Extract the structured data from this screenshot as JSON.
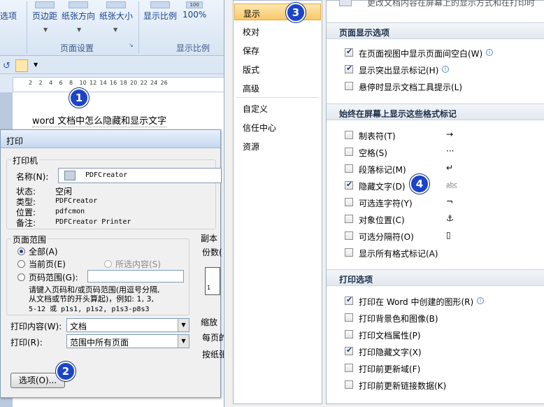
{
  "ribbon": {
    "btn_xuan": "选项",
    "btn_margins": "页边距",
    "btn_orientation": "纸张方向",
    "btn_size": "纸张大小",
    "btn_display_ratio": "显示比例",
    "btn_100": "100%",
    "group_page_setup": "页面设置",
    "group_zoom": "显示比例",
    "icon_100": "100"
  },
  "document": {
    "text": "word 文档中怎么隐藏和显示文字",
    "ruler_numbers": [
      "2",
      "2",
      "4",
      "6",
      "8",
      "10",
      "12",
      "14",
      "16",
      "18",
      "20",
      "22",
      "24",
      "26"
    ]
  },
  "badges": [
    "1",
    "2",
    "3",
    "4"
  ],
  "print_dialog": {
    "title": "打印",
    "printer_legend": "打印机",
    "name_label": "名称(N):",
    "name_value": "PDFCreator",
    "status_label": "状态:",
    "status_value": "空闲",
    "type_label": "类型:",
    "type_value": "PDFCreator",
    "location_label": "位置:",
    "location_value": "pdfcmon",
    "comment_label": "备注:",
    "comment_value": "PDFCreator Printer",
    "range_legend": "页面范围",
    "range_all": "全部(A)",
    "range_current": "当前页(E)",
    "range_selection": "所选内容(S)",
    "range_pages": "页码范围(G):",
    "range_hint_1": "请键入页码和/或页码范围(用逗号分隔,",
    "range_hint_2": "从文档或节的开头算起)，例如: 1, 3,",
    "range_hint_3": "5-12 或 p1s1, p1s2, p1s3-p8s3",
    "copies_legend": "副本",
    "copies_label": "份数(",
    "zoom_legend": "缩放",
    "per_page_label": "每页的",
    "scale_label": "按纸张",
    "print_what_label": "打印内容(W):",
    "print_what_value": "文档",
    "print_label": "打印(R):",
    "print_value": "范围中所有页面",
    "options_button": "选项(O)..."
  },
  "options_dialog": {
    "header_text": "更改文档内容在屏幕上的显示方式和在打印时",
    "nav": [
      "显示",
      "校对",
      "保存",
      "版式",
      "高级",
      "自定义",
      "信任中心",
      "资源"
    ],
    "nav_selected": "显示",
    "sections": {
      "page_display": "页面显示选项",
      "format_marks": "始终在屏幕上显示这些格式标记",
      "print_options": "打印选项"
    },
    "page_display_items": [
      {
        "label": "在页面视图中显示页面间空白(W)",
        "checked": true,
        "info": true
      },
      {
        "label": "显示突出显示标记(H)",
        "checked": true,
        "info": true
      },
      {
        "label": "悬停时显示文档工具提示(L)",
        "checked": false,
        "info": false
      }
    ],
    "format_mark_items": [
      {
        "label": "制表符(T)",
        "checked": false,
        "mark": "→"
      },
      {
        "label": "空格(S)",
        "checked": false,
        "mark": "···"
      },
      {
        "label": "段落标记(M)",
        "checked": false,
        "mark": "↵"
      },
      {
        "label": "隐藏文字(D)",
        "checked": true,
        "mark": "abc"
      },
      {
        "label": "可选连字符(Y)",
        "checked": false,
        "mark": "¬"
      },
      {
        "label": "对象位置(C)",
        "checked": false,
        "mark": "⚓"
      },
      {
        "label": "可选分隔符(O)",
        "checked": false,
        "mark": "▯"
      },
      {
        "label": "显示所有格式标记(A)",
        "checked": false,
        "mark": ""
      }
    ],
    "print_items": [
      {
        "label": "打印在 Word 中创建的图形(R)",
        "checked": true,
        "info": true
      },
      {
        "label": "打印背景色和图像(B)",
        "checked": false,
        "info": false
      },
      {
        "label": "打印文档属性(P)",
        "checked": false,
        "info": false
      },
      {
        "label": "打印隐藏文字(X)",
        "checked": true,
        "info": false
      },
      {
        "label": "打印前更新域(F)",
        "checked": false,
        "info": false
      },
      {
        "label": "打印前更新链接数据(K)",
        "checked": false,
        "info": false
      }
    ]
  }
}
